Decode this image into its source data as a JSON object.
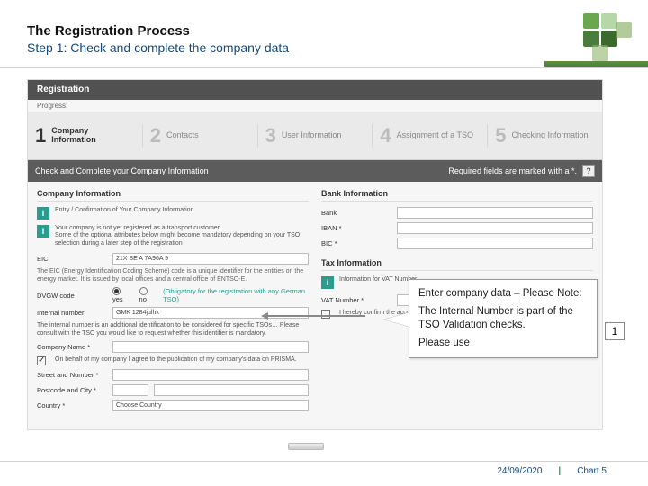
{
  "title": {
    "line1": "The Registration Process",
    "line2": "Step 1: Check and complete the company data"
  },
  "screenshot": {
    "window_title": "Registration",
    "progress_label": "Progress:",
    "steps": [
      {
        "num": "1",
        "label": "Company Information",
        "active": true
      },
      {
        "num": "2",
        "label": "Contacts",
        "active": false
      },
      {
        "num": "3",
        "label": "User Information",
        "active": false
      },
      {
        "num": "4",
        "label": "Assignment of a TSO",
        "active": false
      },
      {
        "num": "5",
        "label": "Checking Information",
        "active": false
      }
    ],
    "section_header": "Check and Complete your Company Information",
    "required_hint": "Required fields are marked with a *.",
    "help_icon": "?",
    "left": {
      "header": "Company Information",
      "notice1": "Entry / Confirmation of Your Company Information",
      "notice2_a": "Your company is not yet registered as a transport customer",
      "notice2_b": "Some of the optional attributes below might become mandatory depending on your TSO selection during a later step of the registration",
      "eic_label": "EIC",
      "eic_value": "21X SE A 7A96A 9",
      "eic_note": "The EIC (Energy Identification Coding Scheme) code is a unique identifier for the entities on the energy market. It is issued by local offices and a central office of ENTSO-E.",
      "dvgw_label": "DVGW code",
      "dvgw_yes": "yes",
      "dvgw_no": "no",
      "dvgw_hint": "(Obligatory for the registration with any German TSO)",
      "internal_label": "Internal number",
      "internal_value": "GMK 1284julhk",
      "internal_note": "The internal number is an additional identification to be considered for specific TSOs… Please consult with the TSO you would like to request whether this identifier is mandatory.",
      "company_name_label": "Company Name *",
      "consent_text": "On behalf of my company I agree to the publication of my company's data on PRISMA.",
      "street_label": "Street and Number *",
      "postcode_label": "Postcode and City *",
      "country_label": "Country *",
      "country_value": "Choose Country"
    },
    "right": {
      "bank_header": "Bank Information",
      "bank_label": "Bank",
      "iban_label": "IBAN *",
      "bic_label": "BIC *",
      "tax_header": "Tax Information",
      "tax_notice": "Information for VAT Number",
      "vat_label": "VAT Number *",
      "confirm_text": "I hereby confirm the accuracy of"
    }
  },
  "callout": {
    "line1": "Enter company data – Please Note:",
    "line2": "The Internal Number is part of the TSO Validation checks.",
    "line3": "Please use",
    "badge": "1"
  },
  "footer": {
    "date": "24/09/2020",
    "sep": "|",
    "chart": "Chart 5"
  }
}
